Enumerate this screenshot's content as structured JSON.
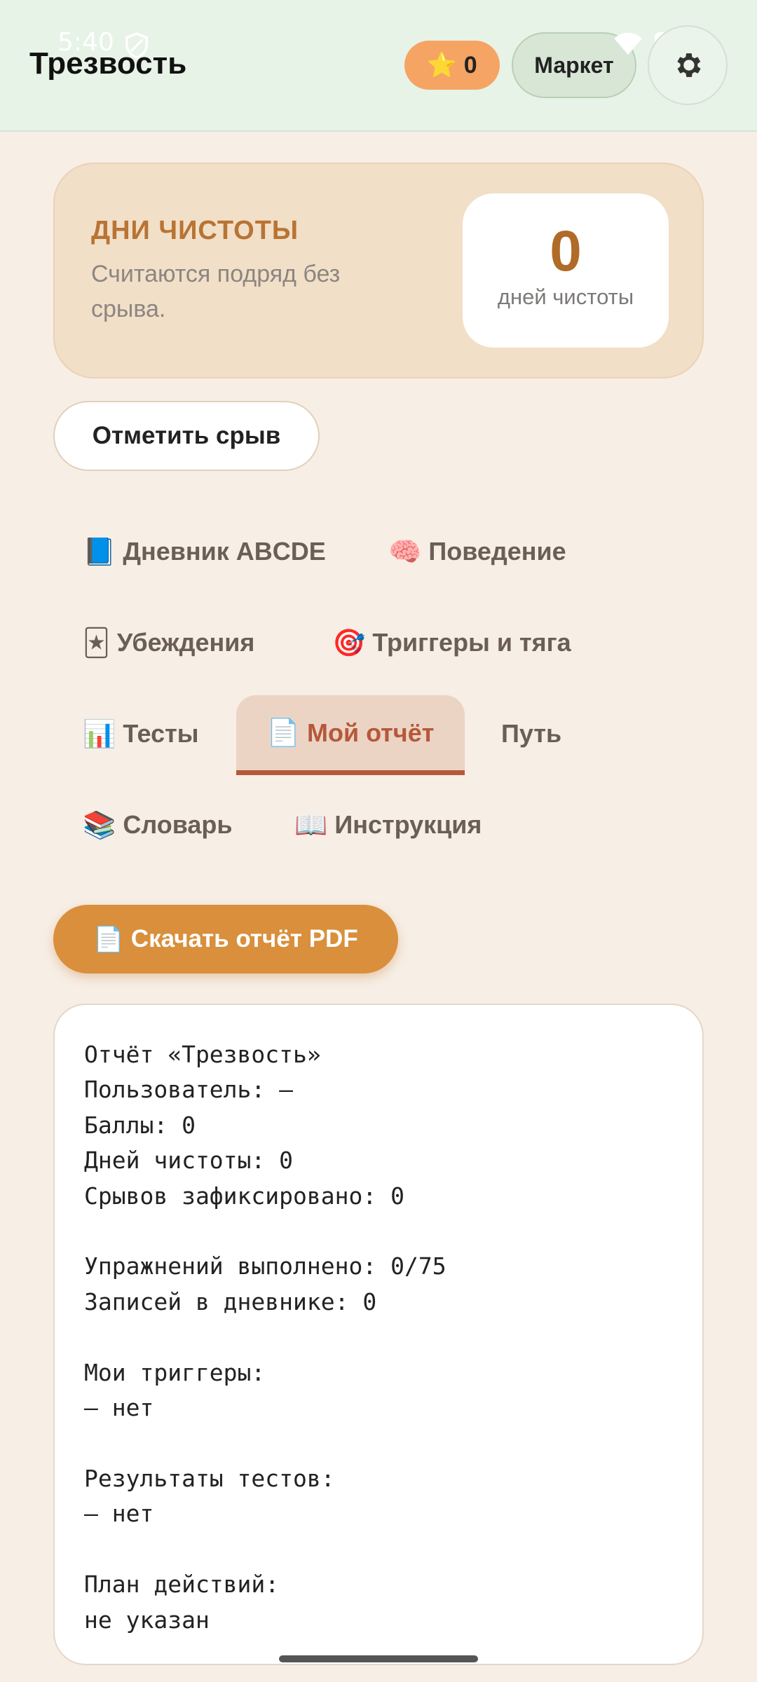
{
  "status_bar": {
    "time": "5:40"
  },
  "header": {
    "title": "Трезвость",
    "points_star": "⭐",
    "points_value": "0",
    "market_label": "Маркет"
  },
  "streak": {
    "title": "ДНИ ЧИСТОТЫ",
    "description": "Считаются подряд без срыва.",
    "value": "0",
    "unit": "дней чистоты"
  },
  "relapse_button": "Отметить срыв",
  "tabs": [
    {
      "icon": "📘",
      "label": "Дневник ABCDE"
    },
    {
      "icon": "🧠",
      "label": "Поведение"
    },
    {
      "icon": "🃏",
      "label": "Убеждения"
    },
    {
      "icon": "🎯",
      "label": "Триггеры и тяга"
    },
    {
      "icon": "📊",
      "label": "Тесты"
    },
    {
      "icon": "📄",
      "label": "Мой отчёт"
    },
    {
      "icon": "",
      "label": "Путь"
    },
    {
      "icon": "📚",
      "label": "Словарь"
    },
    {
      "icon": "📖",
      "label": "Инструкция"
    }
  ],
  "active_tab": "Мой отчёт",
  "pdf_button": {
    "icon": "📄",
    "label": "Скачать отчёт PDF"
  },
  "report_lines": [
    "Отчёт «Трезвость»",
    "Пользователь: —",
    "Баллы: 0",
    "Дней чистоты: 0",
    "Срывов зафиксировано: 0",
    "",
    "Упражнений выполнено: 0/75",
    "Записей в дневнике: 0",
    "",
    "Мои триггеры:",
    "— нет",
    "",
    "Результаты тестов:",
    "— нет",
    "",
    "План действий:",
    "не указан"
  ],
  "colors": {
    "header_bg": "#e7f3e7",
    "page_bg": "#f7eee5",
    "accent_orange": "#d98f3b",
    "active_tab": "#b4593a"
  }
}
